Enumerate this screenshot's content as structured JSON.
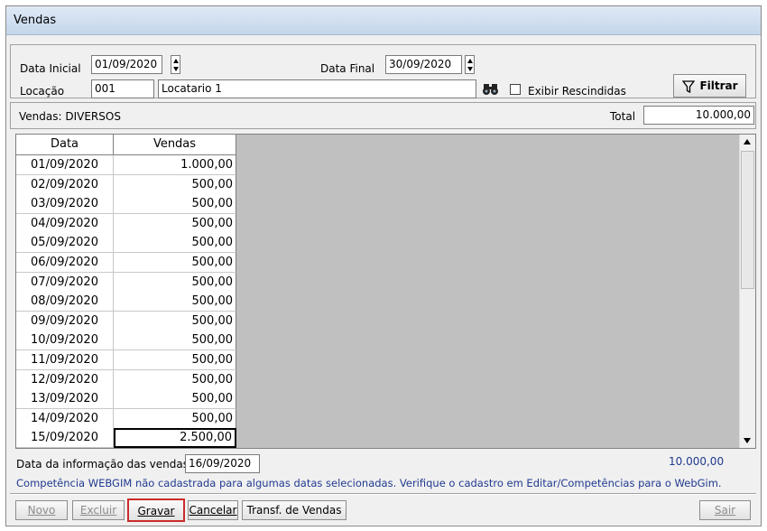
{
  "window": {
    "title": "Vendas"
  },
  "filters": {
    "data_inicial_label": "Data Inicial",
    "data_inicial_value": "01/09/2020",
    "data_final_label": "Data Final",
    "data_final_value": "30/09/2020",
    "locacao_label": "Locação",
    "locacao_code": "001",
    "locacao_name": "Locatario 1",
    "exibir_rescindidas_label": "Exibir Rescindidas",
    "exibir_rescindidas_checked": false,
    "filtrar_label": "Filtrar"
  },
  "summary": {
    "vendas_label": "Vendas: DIVERSOS",
    "total_label": "Total",
    "total_value": "10.000,00"
  },
  "grid": {
    "headers": [
      "Data",
      "Vendas"
    ],
    "rows": [
      {
        "date": "01/09/2020",
        "value": "1.000,00"
      },
      {
        "date": "02/09/2020",
        "value": "500,00"
      },
      {
        "date": "03/09/2020",
        "value": "500,00"
      },
      {
        "date": "04/09/2020",
        "value": "500,00"
      },
      {
        "date": "05/09/2020",
        "value": "500,00"
      },
      {
        "date": "06/09/2020",
        "value": "500,00"
      },
      {
        "date": "07/09/2020",
        "value": "500,00"
      },
      {
        "date": "08/09/2020",
        "value": "500,00"
      },
      {
        "date": "09/09/2020",
        "value": "500,00"
      },
      {
        "date": "10/09/2020",
        "value": "500,00"
      },
      {
        "date": "11/09/2020",
        "value": "500,00"
      },
      {
        "date": "12/09/2020",
        "value": "500,00"
      },
      {
        "date": "13/09/2020",
        "value": "500,00"
      },
      {
        "date": "14/09/2020",
        "value": "500,00"
      },
      {
        "date": "15/09/2020",
        "value": "2.500,00"
      }
    ]
  },
  "footer": {
    "info_date_label": "Data da informação das vendas",
    "info_date_value": "16/09/2020",
    "sum_value": "10.000,00",
    "warning": "Competência WEBGIM não cadastrada para algumas datas selecionadas. Verifique o cadastro em Editar/Competências para o WebGim."
  },
  "buttons": {
    "novo": "Novo",
    "excluir": "Excluir",
    "gravar": "Gravar",
    "cancelar": "Cancelar",
    "transf": "Transf. de Vendas",
    "sair": "Sair"
  },
  "colors": {
    "accent_red": "#cc2a2a",
    "link_blue": "#1f3a8f"
  }
}
